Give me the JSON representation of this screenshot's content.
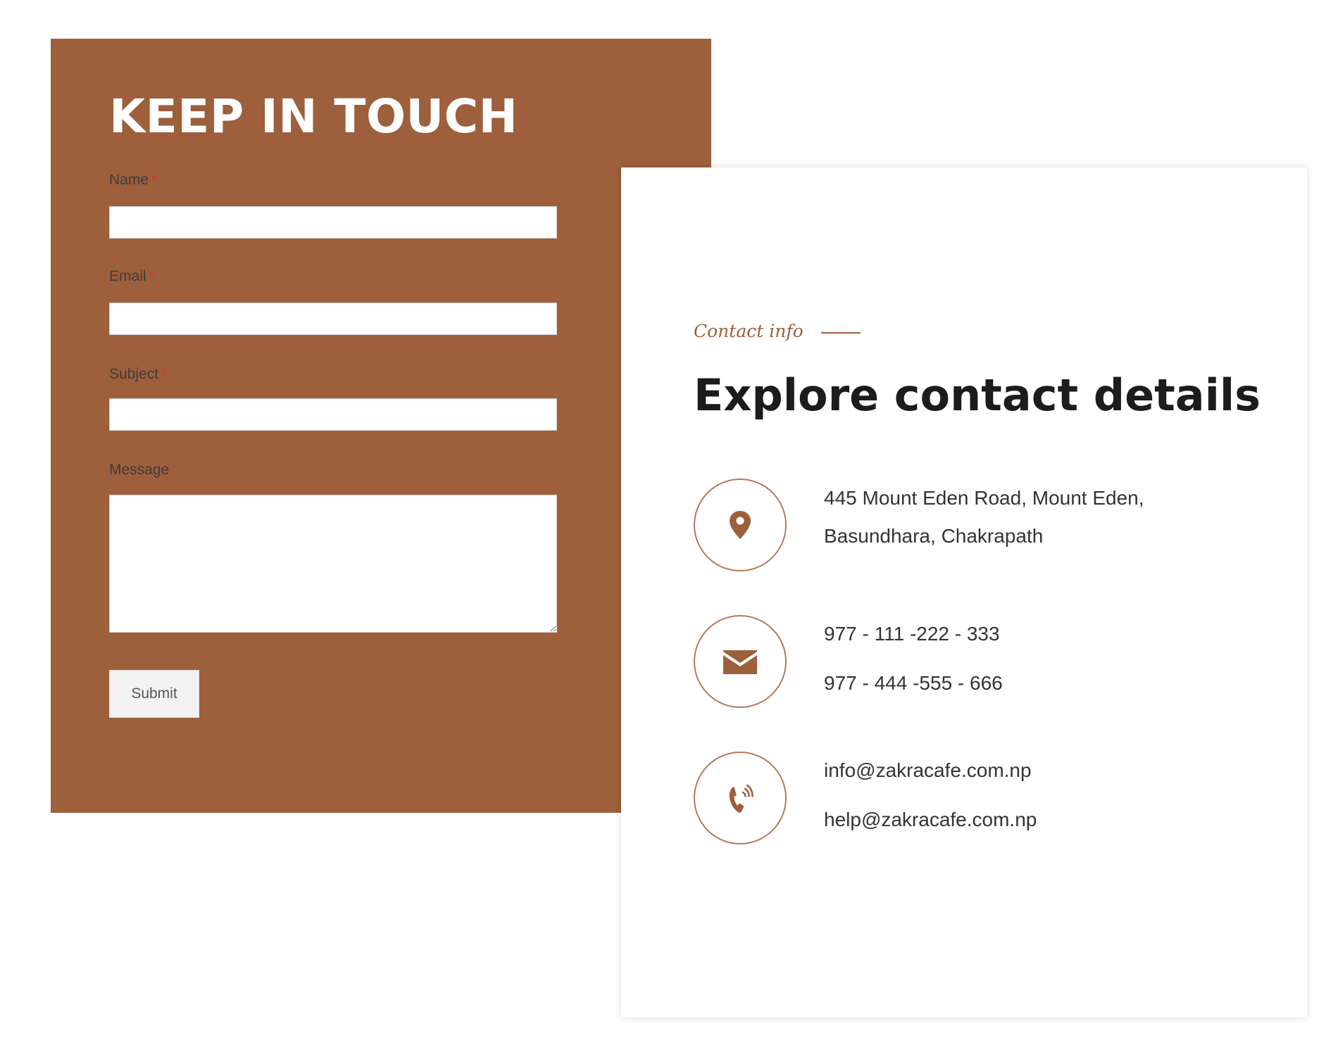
{
  "form": {
    "title": "KEEP IN TOUCH",
    "fields": [
      {
        "label": "Name",
        "required_marker": "*",
        "value": ""
      },
      {
        "label": "Email",
        "required_marker": "*",
        "value": ""
      },
      {
        "label": "Subject",
        "required_marker": "*",
        "value": ""
      },
      {
        "label": "Message",
        "value": ""
      }
    ],
    "submit_label": "Submit"
  },
  "contact": {
    "eyebrow": "Contact info",
    "heading": "Explore contact details",
    "items": [
      {
        "icon": "map-pin-icon",
        "lines": [
          "445 Mount Eden Road, Mount Eden,",
          "Basundhara, Chakrapath"
        ]
      },
      {
        "icon": "envelope-icon",
        "lines": [
          "977 - 111 -222 - 333",
          "977 - 444 -555 - 666"
        ]
      },
      {
        "icon": "phone-icon",
        "lines": [
          "info@zakracafe.com.np",
          "help@zakracafe.com.np"
        ]
      }
    ]
  },
  "colors": {
    "brand_brown": "#9e5f3c",
    "heading_dark": "#1c1c1c",
    "required_red": "#d63a3a"
  }
}
